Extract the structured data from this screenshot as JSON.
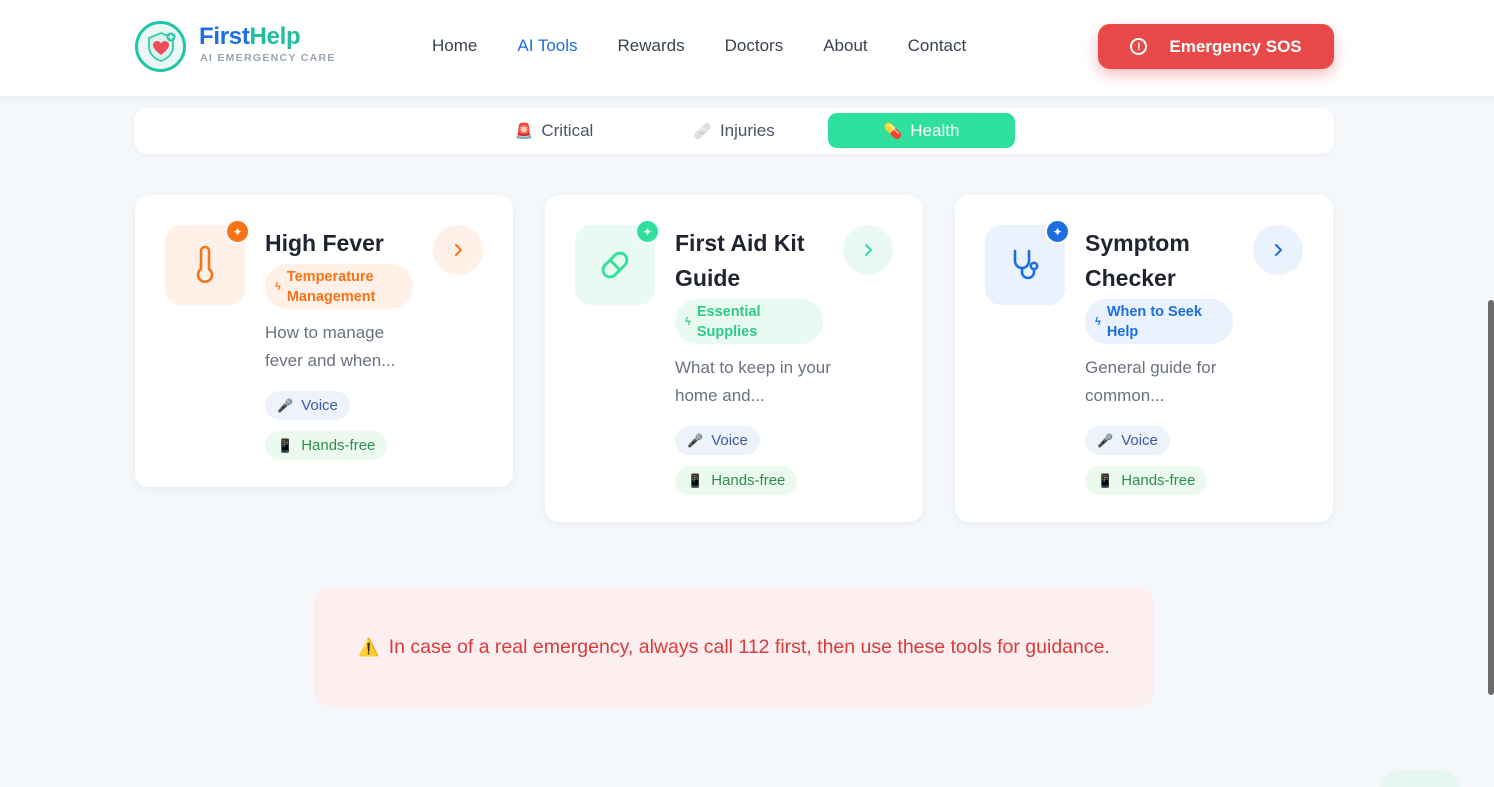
{
  "brand": {
    "title_a": "First",
    "title_b": "Help",
    "subtitle": "AI EMERGENCY CARE"
  },
  "nav": {
    "items": [
      {
        "label": "Home",
        "active": false
      },
      {
        "label": "AI Tools",
        "active": true
      },
      {
        "label": "Rewards",
        "active": false
      },
      {
        "label": "Doctors",
        "active": false
      },
      {
        "label": "About",
        "active": false
      },
      {
        "label": "Contact",
        "active": false
      }
    ]
  },
  "sos": {
    "label": "Emergency SOS",
    "icon": "alert-circle-icon"
  },
  "tabs": [
    {
      "emoji": "🚨",
      "label": "Critical",
      "active": false
    },
    {
      "emoji": "🩹",
      "label": "Injuries",
      "active": false
    },
    {
      "emoji": "💊",
      "label": "Health",
      "active": true
    }
  ],
  "cards": [
    {
      "title": "High Fever",
      "badge": "Temperature Management",
      "desc": "How to manage fever and when...",
      "icon": "thermometer-icon",
      "accent": "#f97316",
      "chips": {
        "voice_emoji": "🎤",
        "voice": "Voice",
        "hands_emoji": "📱",
        "hands": "Hands-free"
      }
    },
    {
      "title": "First Aid Kit Guide",
      "badge": "Essential Supplies",
      "desc": "What to keep in your home and...",
      "icon": "pill-icon",
      "accent": "#2fdf9e",
      "chips": {
        "voice_emoji": "🎤",
        "voice": "Voice",
        "hands_emoji": "📱",
        "hands": "Hands-free"
      }
    },
    {
      "title": "Symptom Checker",
      "badge": "When to Seek Help",
      "desc": "General guide for common...",
      "icon": "stethoscope-icon",
      "accent": "#1d6fe0",
      "chips": {
        "voice_emoji": "🎤",
        "voice": "Voice",
        "hands_emoji": "📱",
        "hands": "Hands-free"
      }
    }
  ],
  "warning": {
    "emoji": "⚠️",
    "text": "In case of a real emergency, always call 112 first, then use these tools for guidance."
  },
  "colors": {
    "primary": "#1d6fe0",
    "teal": "#1fbf9e",
    "green": "#2fdf9e",
    "danger": "#e84848",
    "orange": "#f97316"
  }
}
